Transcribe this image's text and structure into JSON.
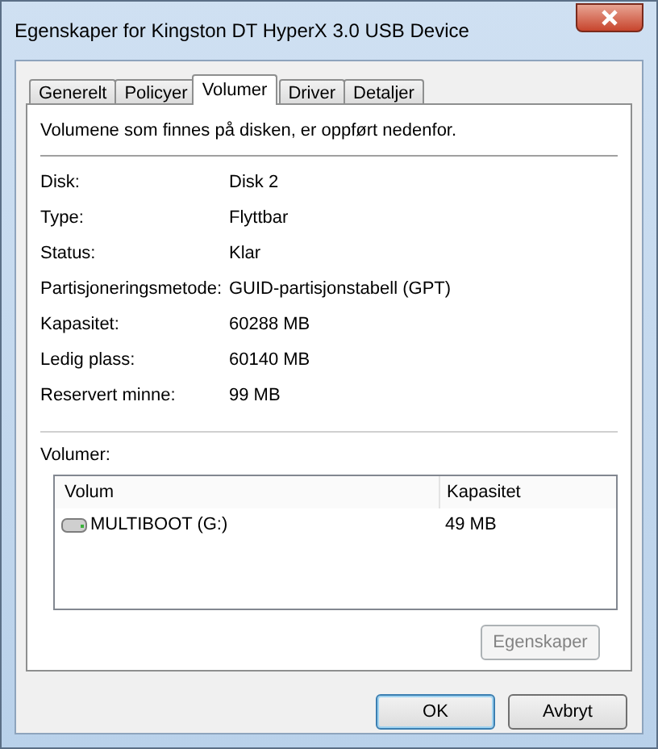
{
  "window": {
    "title": "Egenskaper for Kingston DT HyperX 3.0 USB Device"
  },
  "tabs": [
    {
      "label": "Generelt",
      "selected": false
    },
    {
      "label": "Policyer",
      "selected": false
    },
    {
      "label": "Volumer",
      "selected": true
    },
    {
      "label": "Driver",
      "selected": false
    },
    {
      "label": "Detaljer",
      "selected": false
    }
  ],
  "description": "Volumene som finnes på disken, er oppført nedenfor.",
  "properties": [
    {
      "label": "Disk:",
      "value": "Disk 2"
    },
    {
      "label": "Type:",
      "value": "Flyttbar"
    },
    {
      "label": "Status:",
      "value": "Klar"
    },
    {
      "label": "Partisjoneringsmetode:",
      "value": "GUID-partisjonstabell (GPT)"
    },
    {
      "label": "Kapasitet:",
      "value": "60288 MB"
    },
    {
      "label": "Ledig plass:",
      "value": "60140 MB"
    },
    {
      "label": "Reservert minne:",
      "value": "99 MB"
    }
  ],
  "volumes": {
    "label": "Volumer:",
    "columns": [
      "Volum",
      "Kapasitet"
    ],
    "rows": [
      {
        "name": "MULTIBOOT (G:)",
        "capacity": "49 MB"
      }
    ],
    "button": {
      "label": "Egenskaper",
      "disabled": true
    }
  },
  "buttons": [
    {
      "label": "OK",
      "default": true
    },
    {
      "label": "Avbryt",
      "default": false
    }
  ]
}
